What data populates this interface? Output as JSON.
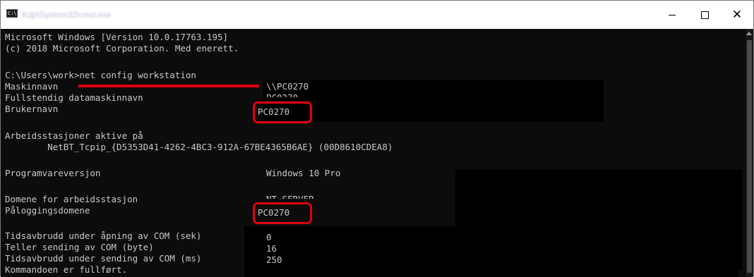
{
  "window": {
    "title": "Kdp\\System32\\cmd.exe",
    "icon_name": "cmd-icon",
    "icon_label": "C:\\",
    "buttons": {
      "minimize": "—",
      "maximize": "☐",
      "close": "✕"
    }
  },
  "console": {
    "header": [
      "Microsoft Windows [Version 10.0.17763.195]",
      "(c) 2018 Microsoft Corporation. Med enerett."
    ],
    "prompt": "C:\\Users\\work>net config workstation",
    "rows": {
      "maskinnavn": {
        "label": "Maskinnavn",
        "value": "\\\\PC0270"
      },
      "fullstendig": {
        "label": "Fullstendig datamaskinnavn",
        "value": "PC0270"
      },
      "brukernavn": {
        "label": "Brukernavn",
        "value": "PC0270"
      },
      "arbeidsstasjoner": {
        "label": "Arbeidsstasjoner aktive på",
        "value": "        NetBT_Tcpip_{D5353D41-4262-4BC3-912A-67BE4365B6AE} (00D8610CDEA8)"
      },
      "programvare": {
        "label": "Programvareversjon",
        "value": "Windows 10 Pro"
      },
      "domene": {
        "label": "Domene for arbeidsstasjon",
        "value": "NT-SERVER"
      },
      "palogging": {
        "label": "Påloggingsdomene",
        "value": "PC0270"
      },
      "tidsavbrudd_apning": {
        "label": "Tidsavbrudd under åpning av COM (sek)",
        "value": "0"
      },
      "teller": {
        "label": "Teller sending av COM (byte)",
        "value": "16"
      },
      "tidsavbrudd_sending": {
        "label": "Tidsavbrudd under sending av COM (ms)",
        "value": "250"
      },
      "fullfort": {
        "label": "Kommandoen er fullført."
      }
    }
  },
  "annotations": {
    "highlight_color": "#e0000f"
  }
}
